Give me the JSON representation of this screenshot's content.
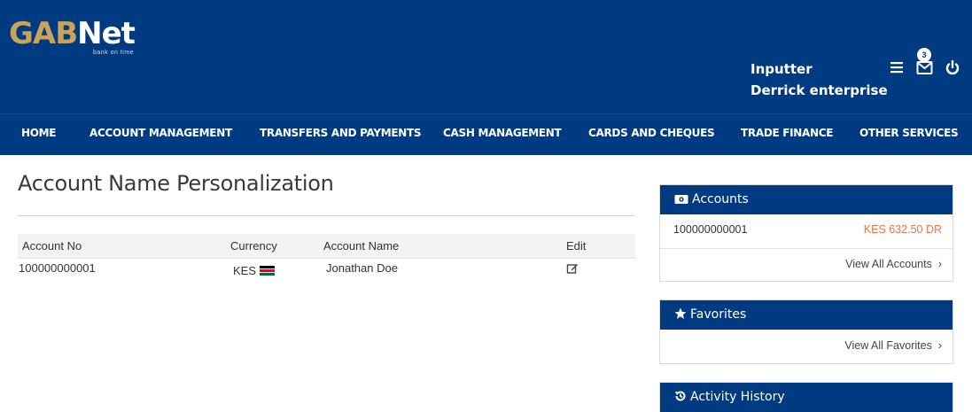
{
  "brand": {
    "logo_text_gab": "GAB",
    "logo_text_net": "Net",
    "tagline": "bank on time"
  },
  "user": {
    "role": "Inputter",
    "company": "Derrick enterprise"
  },
  "header_icons": {
    "menu": "hamburger-icon",
    "messages": "envelope-icon",
    "messages_count": "3",
    "logout": "power-icon"
  },
  "nav": {
    "items": [
      {
        "label": "HOME"
      },
      {
        "label": "ACCOUNT MANAGEMENT"
      },
      {
        "label": "TRANSFERS AND PAYMENTS"
      },
      {
        "label": "CASH MANAGEMENT"
      },
      {
        "label": "CARDS AND CHEQUES"
      },
      {
        "label": "TRADE FINANCE"
      },
      {
        "label": "OTHER SERVICES"
      }
    ]
  },
  "main": {
    "title": "Account Name Personalization",
    "table": {
      "headers": [
        "Account No",
        "Currency",
        "Account Name",
        "Edit"
      ],
      "rows": [
        {
          "account_no": "100000000001",
          "currency": "KES",
          "account_name": "Jonathan Doe"
        }
      ]
    }
  },
  "sidebar": {
    "accounts": {
      "title": "Accounts",
      "rows": [
        {
          "account_no": "100000000001",
          "balance": "KES 632.50 DR"
        }
      ],
      "view_all": "View All Accounts"
    },
    "favorites": {
      "title": "Favorites",
      "view_all": "View All Favorites"
    },
    "activity": {
      "title": "Activity History"
    }
  },
  "colors": {
    "brand_blue": "#003a80",
    "logo_gold": "#c9a35a",
    "debit_orange": "#e8744a"
  }
}
